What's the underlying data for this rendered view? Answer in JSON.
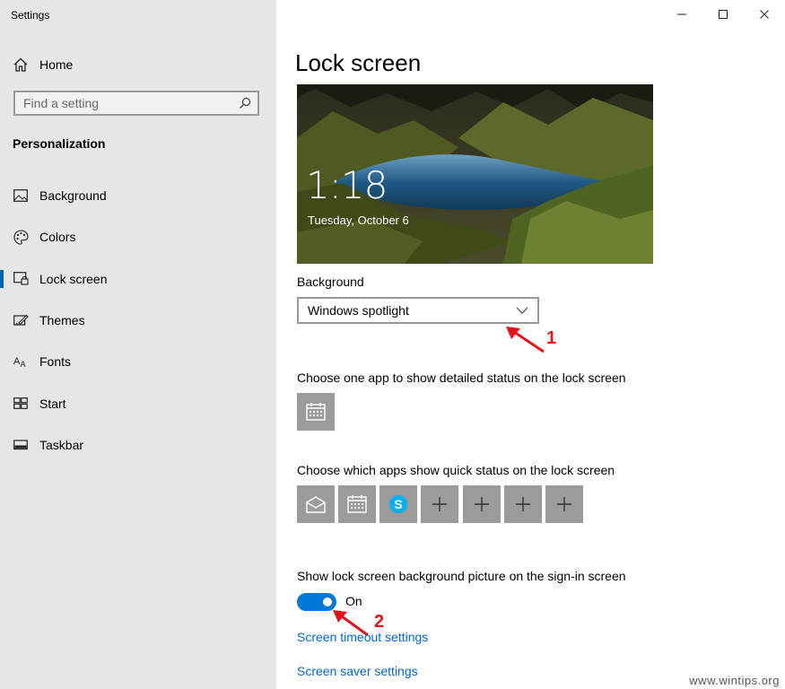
{
  "window": {
    "title": "Settings"
  },
  "sidebar": {
    "home_label": "Home",
    "search_placeholder": "Find a setting",
    "section_title": "Personalization",
    "items": [
      {
        "label": "Background",
        "icon": "picture-icon"
      },
      {
        "label": "Colors",
        "icon": "palette-icon"
      },
      {
        "label": "Lock screen",
        "icon": "lock-screen-icon",
        "active": true
      },
      {
        "label": "Themes",
        "icon": "themes-icon"
      },
      {
        "label": "Fonts",
        "icon": "fonts-icon"
      },
      {
        "label": "Start",
        "icon": "start-icon"
      },
      {
        "label": "Taskbar",
        "icon": "taskbar-icon"
      }
    ]
  },
  "main": {
    "title": "Lock screen",
    "preview": {
      "time": "1:18",
      "date": "Tuesday, October 6"
    },
    "background_label": "Background",
    "background_value": "Windows spotlight",
    "detailed_status_label": "Choose one app to show detailed status on the lock screen",
    "quick_status_label": "Choose which apps show quick status on the lock screen",
    "quick_status_apps": [
      "mail-icon",
      "calendar-icon",
      "skype-icon",
      "plus-icon",
      "plus-icon",
      "plus-icon",
      "plus-icon"
    ],
    "signin_label": "Show lock screen background picture on the sign-in screen",
    "signin_toggle": "On",
    "link_timeout": "Screen timeout settings",
    "link_saver": "Screen saver settings"
  },
  "annotations": {
    "marker1": "1",
    "marker2": "2",
    "color": "#e0141c"
  },
  "watermark": "www.wintips.org",
  "colors": {
    "accent": "#0078d7",
    "sidebar_bg": "#e6e6e6",
    "link": "#0066cc",
    "tile": "#9b9b9b"
  }
}
